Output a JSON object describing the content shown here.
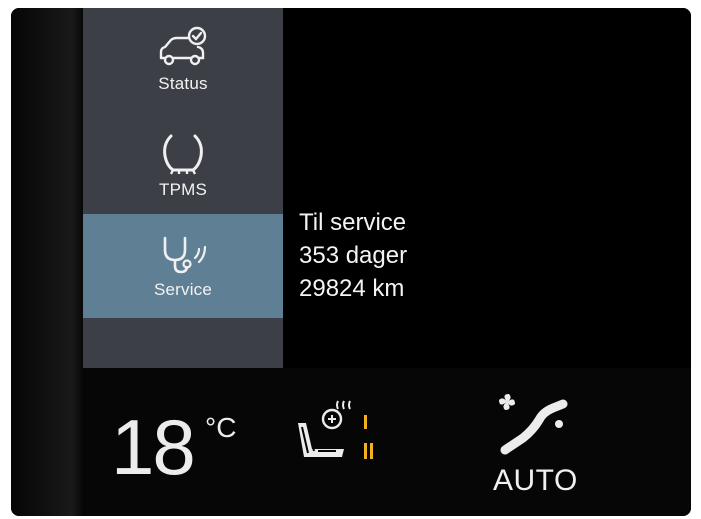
{
  "sidebar": {
    "items": [
      {
        "label": "Status",
        "icon": "car-check-icon"
      },
      {
        "label": "TPMS",
        "icon": "tire-pressure-icon"
      },
      {
        "label": "Service",
        "icon": "stethoscope-service-icon",
        "active": true
      }
    ]
  },
  "service_info": {
    "line1": "Til service",
    "line2": "353 dager",
    "line3": "29824 km"
  },
  "climate": {
    "temperature": "18",
    "unit": "°C",
    "seat_heat_icon": "heated-seat-icon",
    "fan_icon": "fan-airflow-icon",
    "fan_mode": "AUTO"
  },
  "colors": {
    "sidebar_bg": "#3c3f45",
    "sidebar_active": "#5f7f95",
    "seat_level_indicator": "#f2b21c"
  }
}
